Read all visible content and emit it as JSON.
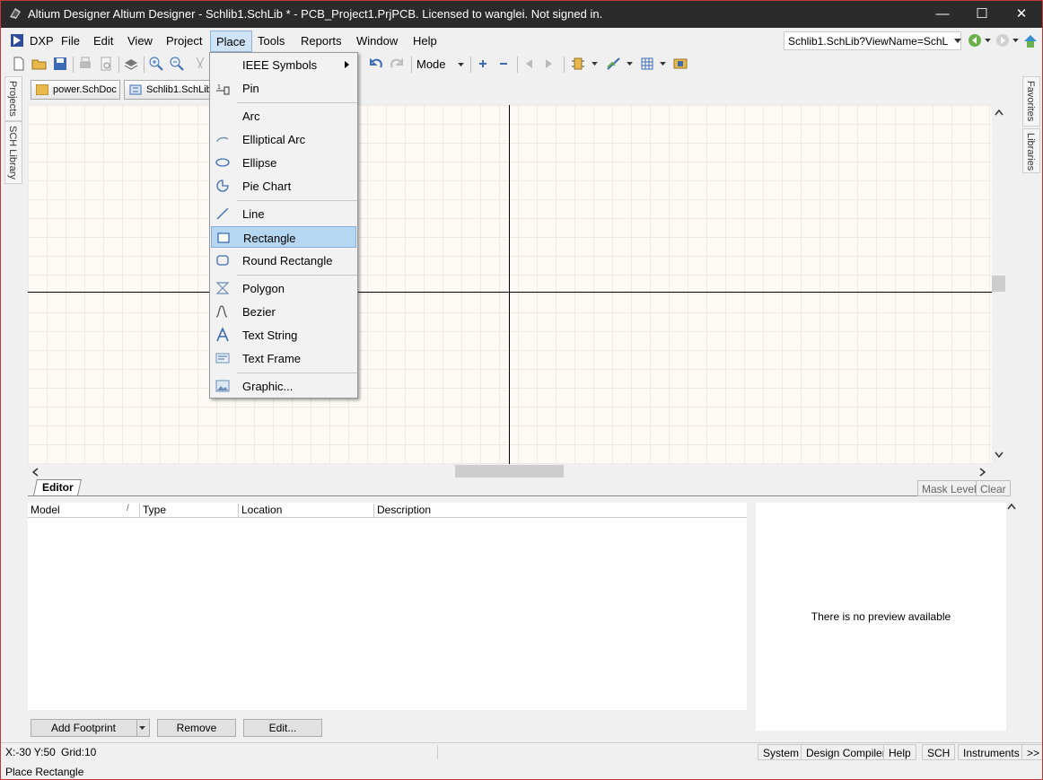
{
  "window": {
    "title": "Altium Designer Altium Designer - Schlib1.SchLib * - PCB_Project1.PrjPCB. Licensed to wanglei. Not signed in.",
    "minimize": "—",
    "maximize": "☐",
    "close": "✕"
  },
  "menubar": {
    "dxp": "DXP",
    "items": [
      "File",
      "Edit",
      "View",
      "Project",
      "Place",
      "Tools",
      "Reports",
      "Window",
      "Help"
    ],
    "open_menu": "Place"
  },
  "address": {
    "value": "Schlib1.SchLib?ViewName=SchL"
  },
  "toolbar": {
    "mode_label": "Mode"
  },
  "doc_tabs": [
    {
      "label": "power.SchDoc",
      "icon": "schdoc-icon"
    },
    {
      "label": "Schlib1.SchLib",
      "icon": "schlib-icon"
    }
  ],
  "side_panels": {
    "left": [
      "Projects",
      "SCH Library"
    ],
    "right": [
      "Favorites",
      "Libraries"
    ]
  },
  "place_menu": {
    "items": [
      {
        "label": "IEEE Symbols",
        "icon": "ieee-icon",
        "submenu": true
      },
      {
        "label": "Pin",
        "icon": "pin-icon"
      },
      {
        "label": "Arc",
        "icon": "arc-icon"
      },
      {
        "label": "Elliptical Arc",
        "icon": "elliptical-arc-icon"
      },
      {
        "label": "Ellipse",
        "icon": "ellipse-icon"
      },
      {
        "label": "Pie Chart",
        "icon": "pie-chart-icon"
      },
      {
        "label": "Line",
        "icon": "line-icon"
      },
      {
        "label": "Rectangle",
        "icon": "rectangle-icon",
        "highlighted": true
      },
      {
        "label": "Round Rectangle",
        "icon": "round-rectangle-icon"
      },
      {
        "label": "Polygon",
        "icon": "polygon-icon"
      },
      {
        "label": "Bezier",
        "icon": "bezier-icon"
      },
      {
        "label": "Text String",
        "icon": "text-string-icon"
      },
      {
        "label": "Text Frame",
        "icon": "text-frame-icon"
      },
      {
        "label": "Graphic...",
        "icon": "graphic-icon"
      }
    ]
  },
  "editor": {
    "tab_label": "Editor",
    "mask_level": "Mask Level",
    "clear": "Clear",
    "columns": [
      "Model",
      "Type",
      "Location",
      "Description"
    ],
    "preview_text": "There is no preview available",
    "buttons": {
      "add_footprint": "Add Footprint",
      "remove": "Remove",
      "edit": "Edit..."
    }
  },
  "status": {
    "coords": "X:-30 Y:50",
    "grid": "Grid:10",
    "message": "Place Rectangle",
    "panels": [
      "System",
      "Design Compiler",
      "Help",
      "SCH",
      "Instruments",
      ">>"
    ]
  },
  "colors": {
    "titlebar": "#2b2b2b",
    "highlight": "#b5d7f2",
    "canvas": "#fdfaf6",
    "frame_border": "#c43a3a"
  }
}
